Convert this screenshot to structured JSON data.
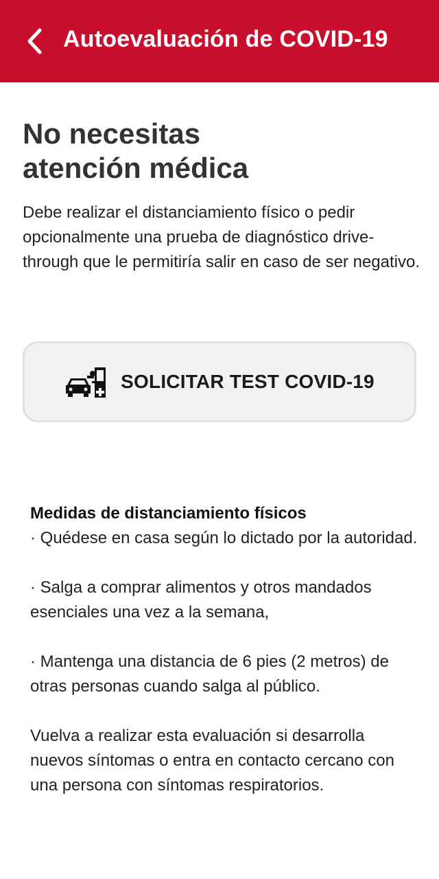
{
  "header": {
    "back_icon": "chevron-left-icon",
    "title": "Autoevaluación de COVID-19",
    "background_color": "#c8102e"
  },
  "result": {
    "title_line1": "No necesitas",
    "title_line2": "atención médica",
    "description": "Debe realizar el distanciamiento físico o pedir opcionalmente una prueba de diagnóstico drive-through que le permitiría salir en caso de ser negativo."
  },
  "test_button": {
    "icon": "drive-through-test-icon",
    "label": "SOLICITAR TEST COVID-19"
  },
  "measures": {
    "heading": "Medidas de distanciamiento físicos",
    "items": [
      "· Quédese en casa según lo dictado por la autoridad.",
      "· Salga a comprar alimentos y otros mandados esenciales una vez a la semana,",
      "· Mantenga una distancia de 6 pies (2 metros) de otras personas cuando salga al público."
    ],
    "closing": "Vuelva a realizar esta evaluación si desarrolla nuevos síntomas o entra en contacto cercano con una persona con síntomas respiratorios."
  }
}
